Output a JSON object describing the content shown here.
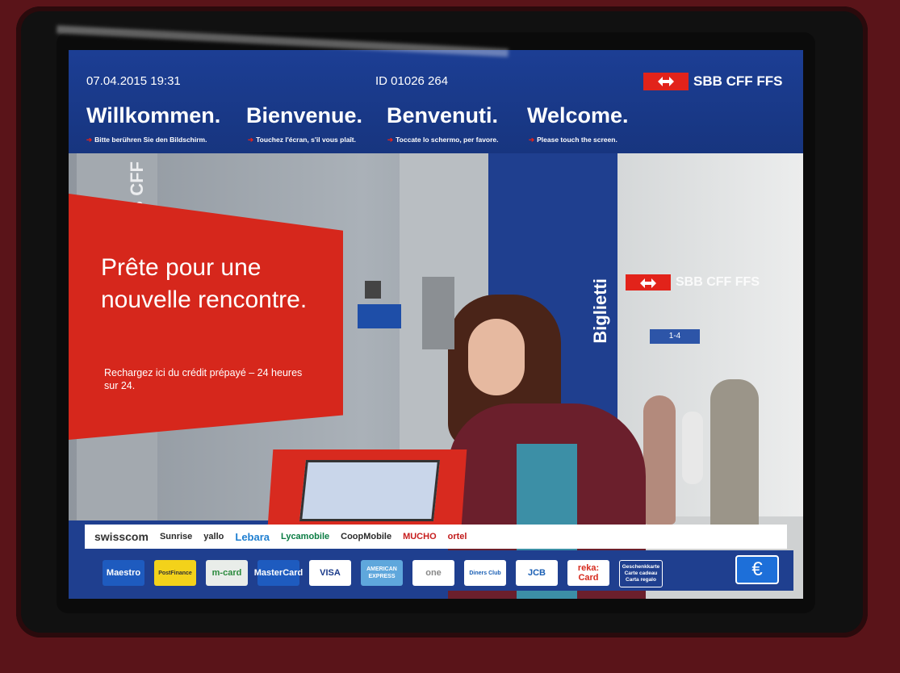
{
  "header": {
    "datetime": "07.04.2015 19:31",
    "machine_id": "ID 01026 264",
    "brand": "SBB CFF FFS",
    "welcome": [
      {
        "title": "Willkommen.",
        "hint": "Bitte berühren Sie den Bildschirm."
      },
      {
        "title": "Bienvenue.",
        "hint": "Touchez l'écran, s'il vous plaît."
      },
      {
        "title": "Benvenuti.",
        "hint": "Toccate lo schermo, per favore."
      },
      {
        "title": "Welcome.",
        "hint": "Please touch the screen."
      }
    ]
  },
  "promo": {
    "title": "Prête pour une nouvelle rencontre.",
    "subtitle": "Rechargez ici du crédit prépayé – 24 heures sur 24."
  },
  "photo": {
    "pillar_text": "SBB CFF",
    "kiosk_sign": "Biglietti",
    "station_brand": "SBB CFF FFS",
    "platform_sign": "1-4"
  },
  "partners": [
    "swisscom",
    "Sunrise",
    "yallo",
    "Lebara",
    "Lycamobile",
    "CoopMobile",
    "MUCHO",
    "ortel"
  ],
  "payment_methods": [
    {
      "label": "Maestro",
      "color": "#1e5bbf",
      "text_color": "#ffffff"
    },
    {
      "label": "PostFinance",
      "color": "#f3d21a",
      "text_color": "#333333"
    },
    {
      "label": "m-card",
      "color": "#e9ede9",
      "text_color": "#2a8a3c"
    },
    {
      "label": "MasterCard",
      "color": "#1e5bbf",
      "text_color": "#ffffff"
    },
    {
      "label": "VISA",
      "color": "#ffffff",
      "text_color": "#1a3a8a"
    },
    {
      "label": "AMERICAN EXPRESS",
      "color": "#5fa7dc",
      "text_color": "#ffffff"
    },
    {
      "label": "one",
      "color": "#ffffff",
      "text_color": "#888888"
    },
    {
      "label": "Diners Club",
      "color": "#ffffff",
      "text_color": "#1a5fb4"
    },
    {
      "label": "JCB",
      "color": "#ffffff",
      "text_color": "#1a5fb4"
    },
    {
      "label": "reka: Card",
      "color": "#ffffff",
      "text_color": "#d62a1e"
    },
    {
      "label": "Geschenkkarte Carte cadeau Carta regalo",
      "color": "#1f3f8f",
      "text_color": "#ffffff"
    }
  ],
  "currency_button": "€"
}
